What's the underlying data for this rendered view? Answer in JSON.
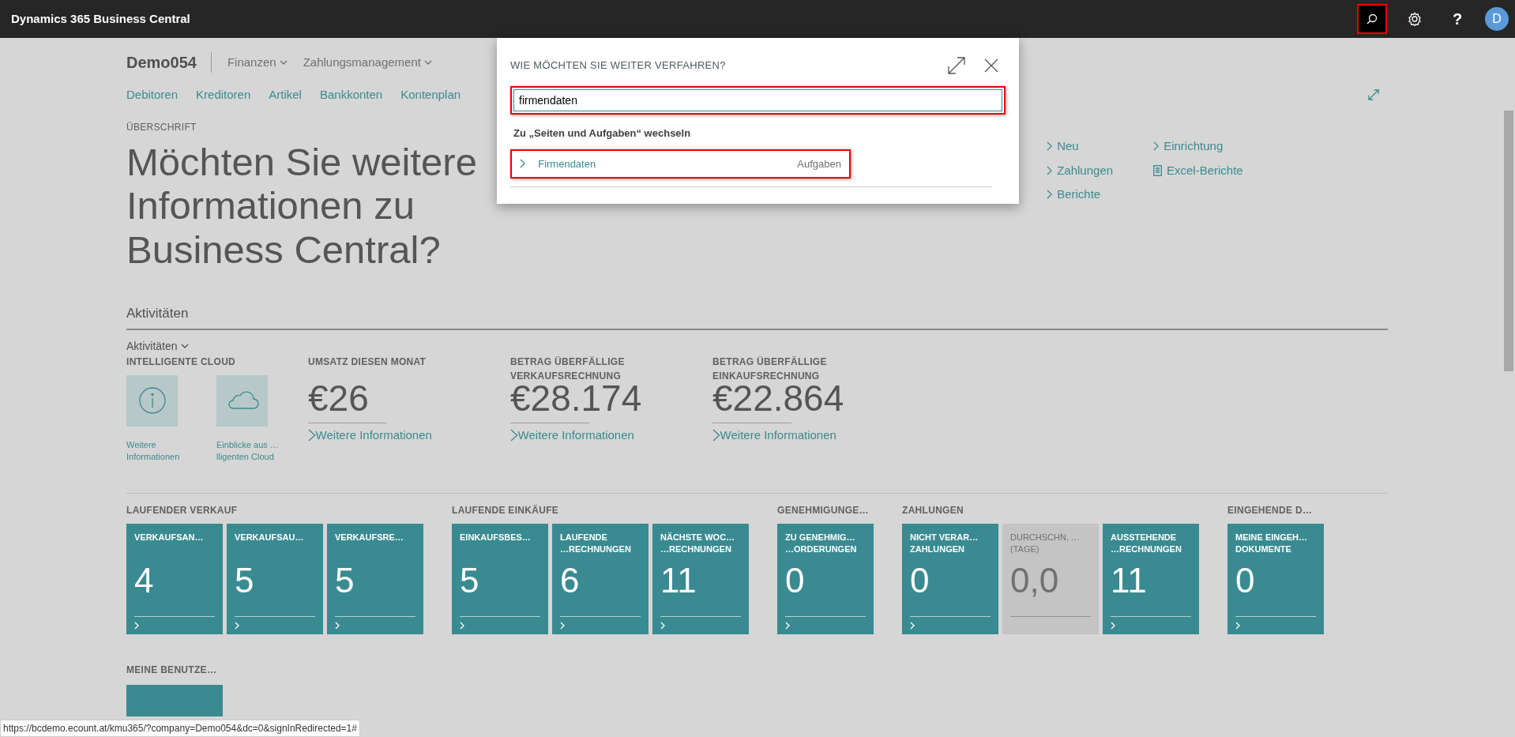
{
  "app_bar": {
    "title": "Dynamics 365 Business Central",
    "search_highlighted": true,
    "help": "?",
    "avatar": "D"
  },
  "company": "Demo054",
  "menus": [
    {
      "label": "Finanzen"
    },
    {
      "label": "Zahlungsmanagement"
    }
  ],
  "nav_links": [
    "Debitoren",
    "Kreditoren",
    "Artikel",
    "Bankkonten",
    "Kontenplan"
  ],
  "headline": {
    "caption": "ÜBERSCHRIFT",
    "text": "Möchten Sie weitere Informationen zu Business Central?"
  },
  "action_columns": [
    [
      {
        "kind": "chevron",
        "label": "Neu"
      },
      {
        "kind": "chevron",
        "label": "Zahlungen"
      },
      {
        "kind": "chevron",
        "label": "Berichte"
      }
    ],
    [
      {
        "kind": "chevron",
        "label": "Einrichtung"
      },
      {
        "kind": "report",
        "label": "Excel-Berichte"
      }
    ]
  ],
  "section_title": "Aktivitäten",
  "activities": {
    "group_label": "Aktivitäten",
    "cloud": {
      "title": "INTELLIGENTE CLOUD",
      "items": [
        {
          "kind": "info",
          "label": "Weitere Informationen"
        },
        {
          "kind": "cloud",
          "label": "Einblicke aus …lligenten Cloud"
        }
      ]
    },
    "kpis": [
      {
        "caption": "UMSATZ DIESEN MONAT",
        "value": "€26",
        "link": "Weitere Informationen"
      },
      {
        "caption": "BETRAG ÜBERFÄLLIGE VERKAUFSRECHNUNG",
        "value": "€28.174",
        "link": "Weitere Informationen"
      },
      {
        "caption": "BETRAG ÜBERFÄLLIGE EINKAUFSRECHNUNG",
        "value": "€22.864",
        "link": "Weitere Informationen"
      }
    ]
  },
  "tile_groups": [
    {
      "title": "LAUFENDER VERKAUF",
      "tiles": [
        {
          "label": "VERKAUFSAN…",
          "value": "4",
          "kind": "teal"
        },
        {
          "label": "VERKAUFSAU…",
          "value": "5",
          "kind": "teal"
        },
        {
          "label": "VERKAUFSRE…",
          "value": "5",
          "kind": "teal"
        }
      ]
    },
    {
      "title": "LAUFENDE EINKÄUFE",
      "tiles": [
        {
          "label": "EINKAUFSBES…",
          "value": "5",
          "kind": "teal"
        },
        {
          "label": "LAUFENDE\n…RECHNUNGEN",
          "value": "6",
          "kind": "teal"
        },
        {
          "label": "NÄCHSTE WOC…\n…RECHNUNGEN",
          "value": "11",
          "kind": "teal"
        }
      ]
    },
    {
      "title": "GENEHMIGUNGE…",
      "tiles": [
        {
          "label": "ZU GENEHMIG…\n…ORDERUNGEN",
          "value": "0",
          "kind": "teal"
        }
      ]
    },
    {
      "title": "ZAHLUNGEN",
      "tiles": [
        {
          "label": "NICHT VERAR…\nZAHLUNGEN",
          "value": "0",
          "kind": "teal"
        },
        {
          "label": "DURCHSCHN. …\n(TAGE)",
          "value": "0,0",
          "kind": "neutral"
        },
        {
          "label": "AUSSTEHENDE\n…RECHNUNGEN",
          "value": "11",
          "kind": "teal"
        }
      ]
    },
    {
      "title": "EINGEHENDE D…",
      "tiles": [
        {
          "label": "MEINE EINGEH…\nDOKUMENTE",
          "value": "0",
          "kind": "teal"
        }
      ]
    }
  ],
  "next_group": {
    "title": "MEINE BENUTZE…"
  },
  "dialog": {
    "title": "WIE MÖCHTEN SIE WEITER VERFAHREN?",
    "search_value": "firmendaten",
    "search_highlighted": true,
    "section": "Zu „Seiten und Aufgaben“ wechseln",
    "results": [
      {
        "label": "Firmendaten",
        "category": "Aufgaben",
        "highlighted": true
      }
    ]
  },
  "status_url": "https://bcdemo.ecount.at/kmu365/?company=Demo054&dc=0&signInRedirected=1#"
}
